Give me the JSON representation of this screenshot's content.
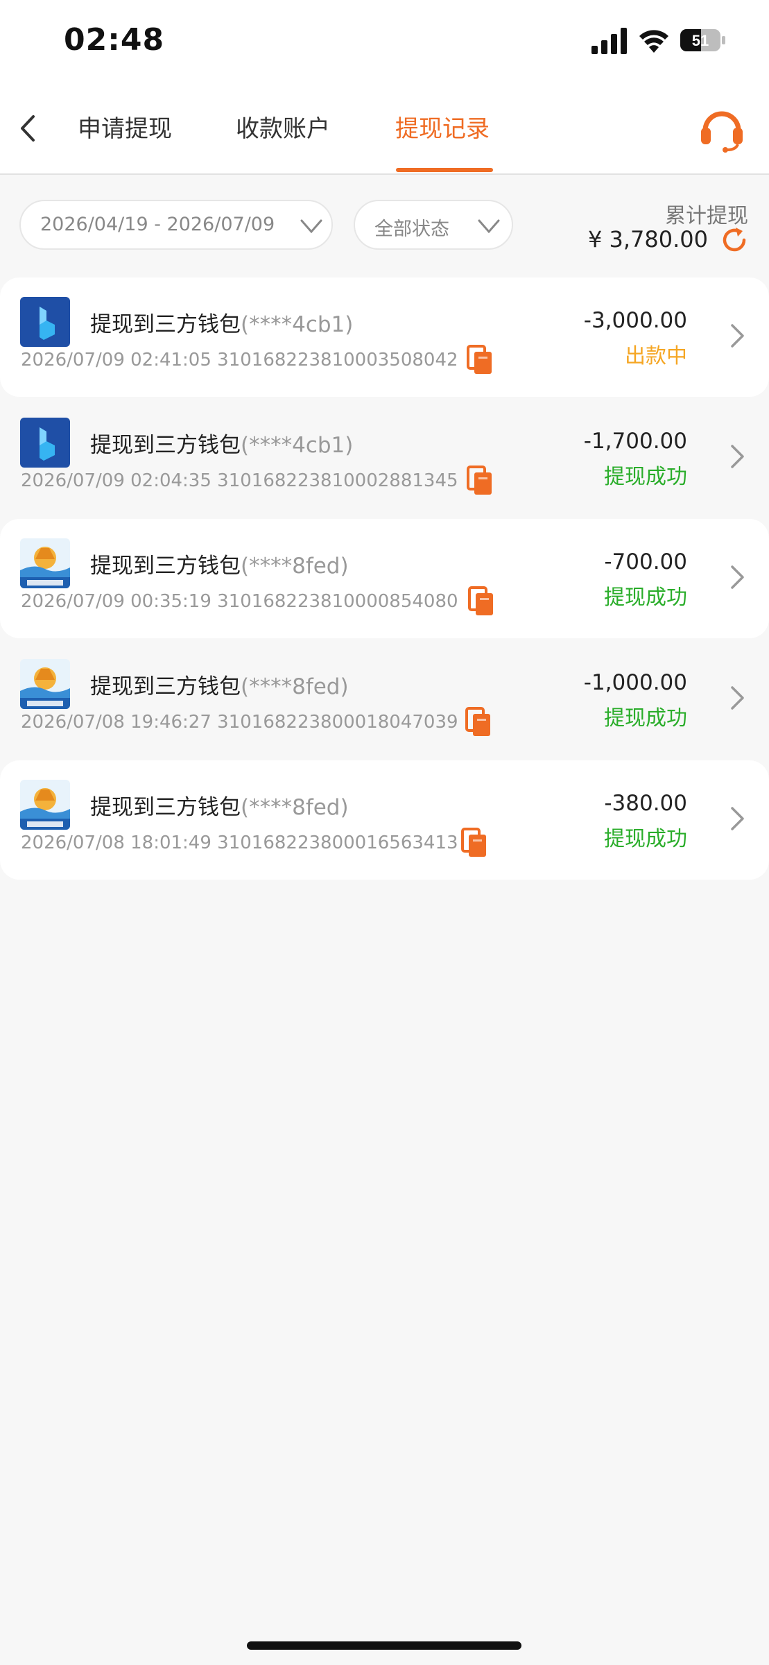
{
  "status_bar": {
    "time": "02:48",
    "battery": "51"
  },
  "tabs": [
    {
      "label": "申请提现"
    },
    {
      "label": "收款账户"
    },
    {
      "label": "提现记录"
    }
  ],
  "filters": {
    "date_range": "2026/04/19 - 2026/07/09",
    "status": "全部状态"
  },
  "summary": {
    "label": "累计提现",
    "amount": "¥ 3,780.00"
  },
  "colors": {
    "accent": "#ef6c24",
    "pending": "#f5a623",
    "success": "#2aad2a"
  },
  "records": [
    {
      "title": "提现到三方钱包",
      "account": "(****4cb1)",
      "datetime": "2026/07/09 02:41:05",
      "order_no": "310168223810003508042",
      "amount": "-3,000.00",
      "status": "出款中",
      "status_type": "pending",
      "logo": "blue-wallet"
    },
    {
      "title": "提现到三方钱包",
      "account": "(****4cb1)",
      "datetime": "2026/07/09 02:04:35",
      "order_no": "310168223810002881345",
      "amount": "-1,700.00",
      "status": "提现成功",
      "status_type": "success",
      "logo": "blue-wallet"
    },
    {
      "title": "提现到三方钱包",
      "account": "(****8fed)",
      "datetime": "2026/07/09 00:35:19",
      "order_no": "310168223810000854080",
      "amount": "-700.00",
      "status": "提现成功",
      "status_type": "success",
      "logo": "golden-wallet"
    },
    {
      "title": "提现到三方钱包",
      "account": "(****8fed)",
      "datetime": "2026/07/08 19:46:27",
      "order_no": "310168223800018047039",
      "amount": "-1,000.00",
      "status": "提现成功",
      "status_type": "success",
      "logo": "golden-wallet"
    },
    {
      "title": "提现到三方钱包",
      "account": "(****8fed)",
      "datetime": "2026/07/08 18:01:49",
      "order_no": "310168223800016563413",
      "amount": "-380.00",
      "status": "提现成功",
      "status_type": "success",
      "logo": "golden-wallet"
    }
  ]
}
